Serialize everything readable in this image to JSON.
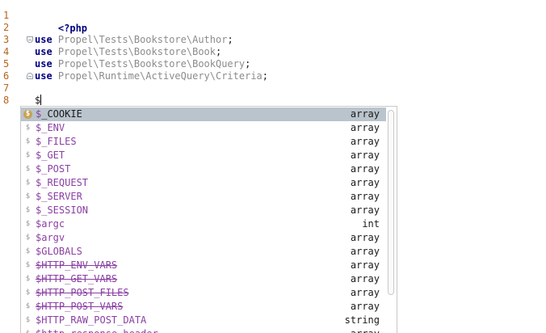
{
  "editor": {
    "line_numbers": [
      "1",
      "2",
      "3",
      "4",
      "5",
      "6",
      "7",
      "8"
    ],
    "lines": {
      "l1": {
        "keyword": "<?php"
      },
      "l3": {
        "keyword": "use",
        "namespace": "Propel\\Tests\\Bookstore\\Author",
        "punct": ";"
      },
      "l4": {
        "keyword": "use",
        "namespace": "Propel\\Tests\\Bookstore\\Book",
        "punct": ";"
      },
      "l5": {
        "keyword": "use",
        "namespace": "Propel\\Tests\\Bookstore\\BookQuery",
        "punct": ";"
      },
      "l6": {
        "keyword": "use",
        "namespace": "Propel\\Runtime\\ActiveQuery\\Criteria",
        "punct": ";"
      },
      "l8": {
        "typed": "$"
      }
    }
  },
  "autocomplete": {
    "icon_glyph": "$",
    "items": [
      {
        "name": "_COOKIE",
        "type": "array",
        "selected": true,
        "deprecated": false
      },
      {
        "name": "_ENV",
        "type": "array",
        "selected": false,
        "deprecated": false
      },
      {
        "name": "_FILES",
        "type": "array",
        "selected": false,
        "deprecated": false
      },
      {
        "name": "_GET",
        "type": "array",
        "selected": false,
        "deprecated": false
      },
      {
        "name": "_POST",
        "type": "array",
        "selected": false,
        "deprecated": false
      },
      {
        "name": "_REQUEST",
        "type": "array",
        "selected": false,
        "deprecated": false
      },
      {
        "name": "_SERVER",
        "type": "array",
        "selected": false,
        "deprecated": false
      },
      {
        "name": "_SESSION",
        "type": "array",
        "selected": false,
        "deprecated": false
      },
      {
        "name": "argc",
        "type": "int",
        "selected": false,
        "deprecated": false
      },
      {
        "name": "argv",
        "type": "array",
        "selected": false,
        "deprecated": false
      },
      {
        "name": "GLOBALS",
        "type": "array",
        "selected": false,
        "deprecated": false
      },
      {
        "name": "HTTP_ENV_VARS",
        "type": "array",
        "selected": false,
        "deprecated": true
      },
      {
        "name": "HTTP_GET_VARS",
        "type": "array",
        "selected": false,
        "deprecated": true
      },
      {
        "name": "HTTP_POST_FILES",
        "type": "array",
        "selected": false,
        "deprecated": true
      },
      {
        "name": "HTTP_POST_VARS",
        "type": "array",
        "selected": false,
        "deprecated": true
      },
      {
        "name": "HTTP_RAW_POST_DATA",
        "type": "string",
        "selected": false,
        "deprecated": false
      },
      {
        "name": "http_response_header",
        "type": "array",
        "selected": false,
        "deprecated": false
      }
    ]
  },
  "colors": {
    "keyword": "#000080",
    "namespace": "#8c8c8c",
    "line_number": "#b5651d",
    "variable": "#8a3fa3",
    "selection": "#bac4cc"
  }
}
